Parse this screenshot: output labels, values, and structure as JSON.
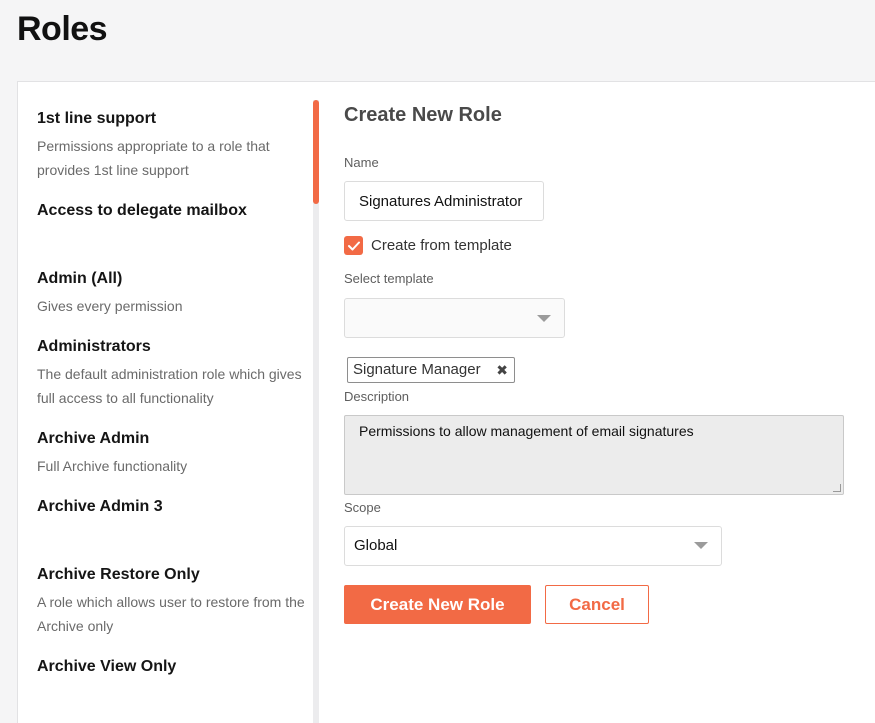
{
  "page": {
    "title": "Roles"
  },
  "roles": [
    {
      "name": "1st line support",
      "description": "Permissions appropriate to a role that provides 1st line support"
    },
    {
      "name": "Access to delegate mailbox",
      "description": ""
    },
    {
      "name": "Admin (All)",
      "description": "Gives every permission"
    },
    {
      "name": "Administrators",
      "description": "The default administration role which gives full access to all functionality"
    },
    {
      "name": "Archive Admin",
      "description": "Full Archive functionality"
    },
    {
      "name": "Archive Admin 3",
      "description": ""
    },
    {
      "name": "Archive Restore Only",
      "description": "A role which allows user to restore from the Archive only"
    },
    {
      "name": "Archive View Only",
      "description": ""
    }
  ],
  "form": {
    "title": "Create New Role",
    "name_label": "Name",
    "name_value": "Signatures Administrator",
    "create_from_template_label": "Create from template",
    "create_from_template_checked": true,
    "select_template_label": "Select template",
    "select_template_value": "",
    "template_tag": "Signature Manager",
    "description_label": "Description",
    "description_value": "Permissions to allow management of email signatures",
    "scope_label": "Scope",
    "scope_value": "Global",
    "create_button": "Create New Role",
    "cancel_button": "Cancel"
  },
  "colors": {
    "accent": "#f26a45",
    "background": "#f5f5f6"
  },
  "icons": {
    "checkbox": "check-icon",
    "select": "chevron-down-icon",
    "tag_remove": "close-icon"
  }
}
